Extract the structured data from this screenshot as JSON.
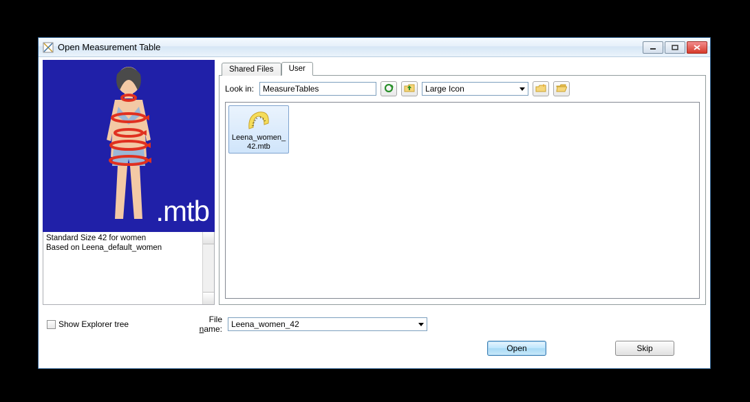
{
  "window": {
    "title": "Open Measurement Table"
  },
  "preview": {
    "ext_label": ".mtb",
    "description_line1": "Standard Size 42 for women",
    "description_line2": "Based on Leena_default_women"
  },
  "tabs": {
    "shared": "Shared Files",
    "user": "User",
    "active": "user"
  },
  "toolbar": {
    "lookin_label": "Look in:",
    "lookin_value": "MeasureTables",
    "view_mode": "Large Icon"
  },
  "files": [
    {
      "name": "Leena_women_42.mtb"
    }
  ],
  "bottom": {
    "show_tree_label": "Show Explorer tree",
    "show_tree_checked": false,
    "filename_label_prefix": "File ",
    "filename_label_underlined": "n",
    "filename_label_suffix": "ame:",
    "filename_value": "Leena_women_42",
    "open_label": "Open",
    "skip_label": "Skip"
  }
}
